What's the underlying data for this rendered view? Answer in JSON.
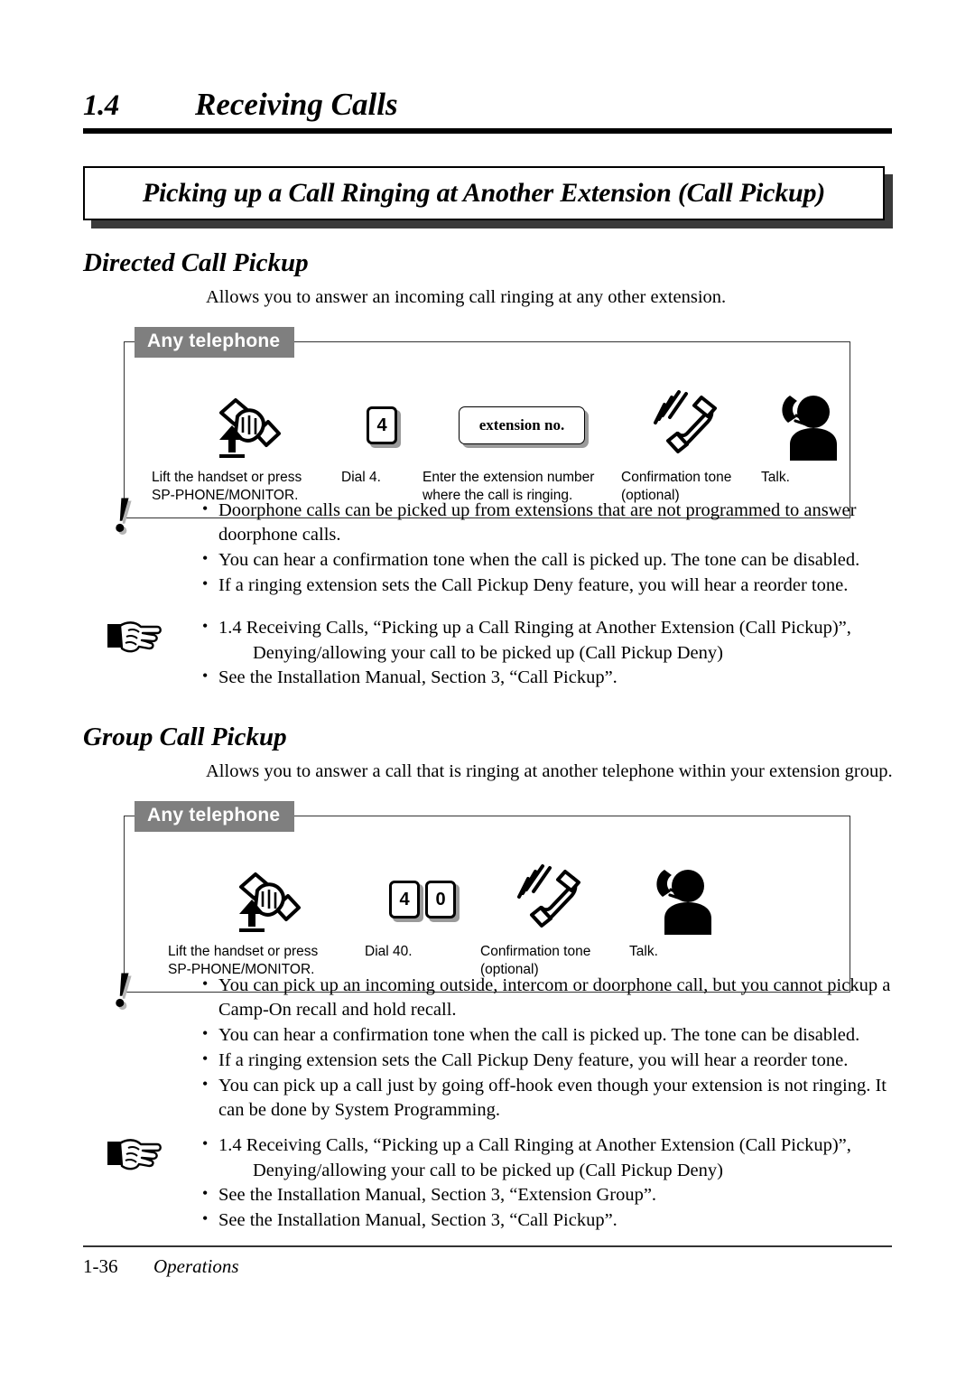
{
  "document": {
    "section_number": "1.4",
    "section_title": "Receiving Calls",
    "feature_title": "Picking up a Call Ringing at Another Extension (Call Pickup)"
  },
  "subsections": [
    {
      "heading": "Directed Call Pickup",
      "description": "Allows you to answer an incoming call ringing at any other extension.",
      "procedure": {
        "tab_label": "Any telephone",
        "steps": [
          {
            "icon": "lift-handset-icon",
            "label": "Lift the handset or press\nSP-PHONE/MONITOR."
          },
          {
            "icon": "keypad-icon",
            "keys": [
              "4"
            ],
            "label": "Dial 4."
          },
          {
            "icon": "extension-number-box-icon",
            "box_text": "extension no.",
            "label": "Enter the extension number\nwhere the call is ringing."
          },
          {
            "icon": "ringing-handset-icon",
            "label": "Confirmation tone\n(optional)"
          },
          {
            "icon": "talking-person-icon",
            "label": "Talk."
          }
        ]
      },
      "caution": {
        "icon": "exclamation-icon",
        "items": [
          "Doorphone calls can be picked up from extensions that are not programmed to answer doorphone calls.",
          "You can hear a confirmation tone when the call is picked up. The tone can be disabled.",
          "If a ringing extension sets the Call Pickup Deny feature, you will hear a reorder tone."
        ]
      },
      "reference": {
        "icon": "pointing-hand-icon",
        "items": [
          "1.4 Receiving Calls, “Picking up a Call Ringing at Another Extension (Call Pickup)”,",
          "See the Installation Manual, Section 3, “Call Pickup”."
        ],
        "sub_item": "Denying/allowing your call to be picked up (Call Pickup Deny)"
      }
    },
    {
      "heading": "Group Call Pickup",
      "description": "Allows you to answer a call that is ringing at another telephone within your extension group.",
      "procedure": {
        "tab_label": "Any telephone",
        "steps": [
          {
            "icon": "lift-handset-icon",
            "label": "Lift the handset or press\nSP-PHONE/MONITOR."
          },
          {
            "icon": "keypad-icon",
            "keys": [
              "4",
              "0"
            ],
            "label": "Dial 40."
          },
          {
            "icon": "ringing-handset-icon",
            "label": "Confirmation tone\n(optional)"
          },
          {
            "icon": "talking-person-icon",
            "label": "Talk."
          }
        ]
      },
      "caution": {
        "icon": "exclamation-icon",
        "items": [
          "You can pick up an incoming outside, intercom or doorphone call, but you cannot pickup a Camp-On recall and hold recall.",
          "You can hear a confirmation tone when the call is picked up. The tone can be disabled.",
          "If a ringing extension sets the Call Pickup Deny feature, you will hear a reorder tone.",
          "You can pick up a call just by going off-hook even though your extension is not ringing. It can be done by System Programming."
        ]
      },
      "reference": {
        "icon": "pointing-hand-icon",
        "items": [
          "1.4 Receiving Calls, “Picking up a Call Ringing at Another Extension (Call Pickup)”,",
          "See the Installation Manual, Section 3, “Extension Group”.",
          "See the Installation Manual, Section 3, “Call Pickup”."
        ],
        "sub_item": "Denying/allowing your call to be picked up (Call Pickup Deny)"
      }
    }
  ],
  "footer": {
    "page_number": "1-36",
    "label": "Operations"
  },
  "colors": {
    "tab_background": "#7f7f7f",
    "tab_text": "#ffffff",
    "shadow": "#3a3a3a",
    "rule": "#000000"
  }
}
